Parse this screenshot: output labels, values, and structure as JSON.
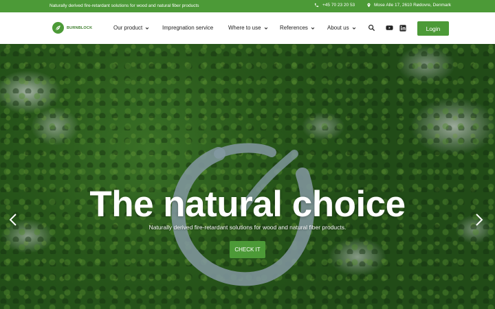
{
  "topbar": {
    "tagline": "Naturally derived fire-retardant solutions for wood and natural fiber products",
    "phone": "+45 70 23 20 53",
    "address": "Mose Alle 17, 2610 Rødovre, Denmark"
  },
  "brand": {
    "name": "BURNBLOCK",
    "accent": "#4c9a37"
  },
  "nav": {
    "items": [
      {
        "label": "Our product",
        "has_dropdown": true
      },
      {
        "label": "Impregnation service",
        "has_dropdown": false
      },
      {
        "label": "Where to use",
        "has_dropdown": true
      },
      {
        "label": "References",
        "has_dropdown": true
      },
      {
        "label": "About us",
        "has_dropdown": true
      }
    ],
    "icons": [
      "search-icon",
      "youtube-icon",
      "linkedin-icon"
    ],
    "login_label": "Login"
  },
  "hero": {
    "title": "The natural choice",
    "subtitle": "Naturally derived fire-retardant solutions for wood and natural fiber products.",
    "cta_label": "CHECK IT",
    "prev_icon": "chevron-left-icon",
    "next_icon": "chevron-right-icon"
  }
}
